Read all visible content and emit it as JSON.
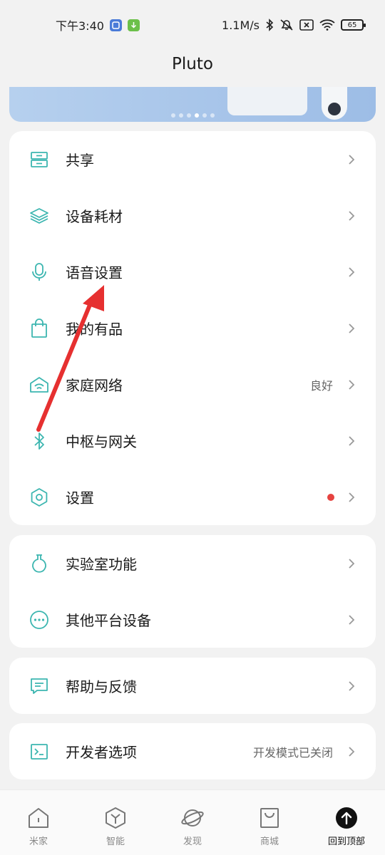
{
  "status_bar": {
    "time": "下午3:40",
    "network_speed": "1.1M/s",
    "battery": "65"
  },
  "header": {
    "title": "Pluto"
  },
  "menu_group_1": [
    {
      "label": "共享",
      "icon": "share-icon"
    },
    {
      "label": "设备耗材",
      "icon": "layers-icon"
    },
    {
      "label": "语音设置",
      "icon": "microphone-icon"
    },
    {
      "label": "我的有品",
      "icon": "shopping-bag-icon"
    },
    {
      "label": "家庭网络",
      "icon": "home-wifi-icon",
      "value": "良好"
    },
    {
      "label": "中枢与网关",
      "icon": "bluetooth-icon"
    },
    {
      "label": "设置",
      "icon": "hexagon-settings-icon",
      "badge": "red-dot"
    }
  ],
  "menu_group_2": [
    {
      "label": "实验室功能",
      "icon": "flask-icon"
    },
    {
      "label": "其他平台设备",
      "icon": "more-circle-icon"
    }
  ],
  "menu_group_3": [
    {
      "label": "帮助与反馈",
      "icon": "feedback-icon"
    }
  ],
  "menu_group_4": [
    {
      "label": "开发者选项",
      "icon": "terminal-icon",
      "value": "开发模式已关闭"
    }
  ],
  "bottom_nav": [
    {
      "label": "米家",
      "icon": "home-icon"
    },
    {
      "label": "智能",
      "icon": "cube-icon"
    },
    {
      "label": "发现",
      "icon": "planet-icon"
    },
    {
      "label": "商城",
      "icon": "shop-bag-icon"
    },
    {
      "label": "回到顶部",
      "icon": "arrow-up-circle-icon",
      "active": true
    }
  ],
  "colors": {
    "accent": "#3cb6b0",
    "alert": "#e64340",
    "annotation": "#e63030"
  }
}
